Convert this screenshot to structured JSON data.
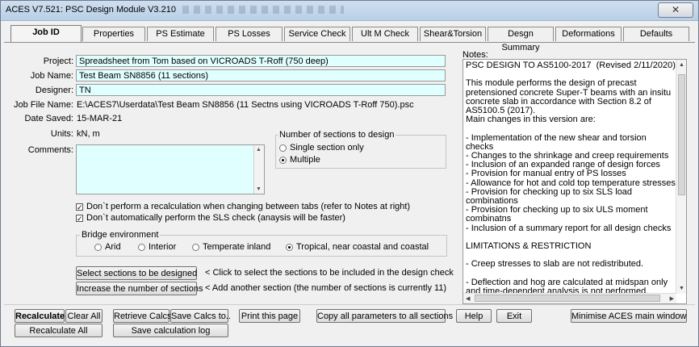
{
  "window": {
    "title": "ACES V7.521: PSC Design Module V3.210",
    "close_glyph": "✕"
  },
  "tabs": [
    {
      "label": "Job ID"
    },
    {
      "label": "Properties"
    },
    {
      "label": "PS Estimate"
    },
    {
      "label": "PS Losses"
    },
    {
      "label": "Service Check"
    },
    {
      "label": "Ult M Check"
    },
    {
      "label": "Shear&Torsion"
    },
    {
      "label": "Desgn Summary"
    },
    {
      "label": "Deformations"
    },
    {
      "label": "Defaults"
    }
  ],
  "form": {
    "project_label": "Project:",
    "project_value": "Spreadsheet from Tom based on VICROADS T-Roff (750 deep)",
    "job_name_label": "Job Name:",
    "job_name_value": "Test Beam SN8856  (11 sections)",
    "designer_label": "Designer:",
    "designer_value": "TN",
    "job_file_label": "Job File Name:",
    "job_file_value": "E:\\ACES7\\Userdata\\Test Beam SN8856 (11 Sectns using VICROADS T-Roff 750).psc",
    "date_saved_label": "Date Saved:",
    "date_saved_value": "15-MAR-21",
    "units_label": "Units:",
    "units_value": "kN,  m",
    "comments_label": "Comments:",
    "comments_value": ""
  },
  "sections_group": {
    "title": "Number of sections to design",
    "options": [
      "Single section only",
      "Multiple"
    ],
    "selected": "Multiple"
  },
  "checks": [
    {
      "label": "Don`t perform a recalculation when changing between tabs (refer to Notes at right)",
      "checked": true
    },
    {
      "label": "Don`t automatically perform the SLS check (anaysis will be faster)",
      "checked": true
    }
  ],
  "environment": {
    "title": "Bridge environment",
    "options": [
      "Arid",
      "Interior",
      "Temperate inland",
      "Tropical, near coastal and coastal"
    ],
    "selected": "Tropical, near coastal and coastal"
  },
  "section_buttons": {
    "select_label": "Select sections to be designed",
    "select_hint": "< Click to select the sections to be included in the design check",
    "increase_label": "Increase the number of sections",
    "increase_hint": "< Add another section (the number of sections is currently  11)"
  },
  "notes": {
    "label": "Notes:",
    "text": "PSC DESIGN TO AS5100-2017  (Revised 2/11/2020)\n\nThis module performs the design of precast pretensioned concrete Super-T beams with an insitu concrete slab in accordance with Section 8.2 of AS5100.5 (2017).\nMain changes in this version are:\n\n- Implementation of the new shear and torsion checks\n- Changes to the shrinkage and creep requirements\n- Inclusion of an expanded range of design forces\n- Provision for manual entry of PS losses\n- Allowance for hot and cold top temperature stresses\n- Provision for checking up to six SLS load combinations\n- Provision for checking up to six ULS moment combinatns\n- Inclusion of a summary report for all design checks\n\nLIMITATIONS & RESTRICTION\n\n- Creep stresses to slab are not redistributed.\n\n- Deflection and hog are calculated at midspan only and time-dependent analysis is not performed.\n\n- Debonding lengths are not calculated."
  },
  "bottom_buttons": {
    "recalculate": "Recalculate",
    "clear_all": "Clear All",
    "retrieve_calcs": "Retrieve Calcs",
    "save_calcs_to": "Save Calcs to..",
    "print_page": "Print this page",
    "copy_all": "Copy all parameters to all sections",
    "help": "Help",
    "exit": "Exit",
    "minimise": "Minimise ACES main window",
    "recalculate_all": "Recalculate All",
    "save_log": "Save calculation log"
  },
  "colors": {
    "field_bg": "#e0ffff",
    "window_bg": "#f0f0f0"
  }
}
